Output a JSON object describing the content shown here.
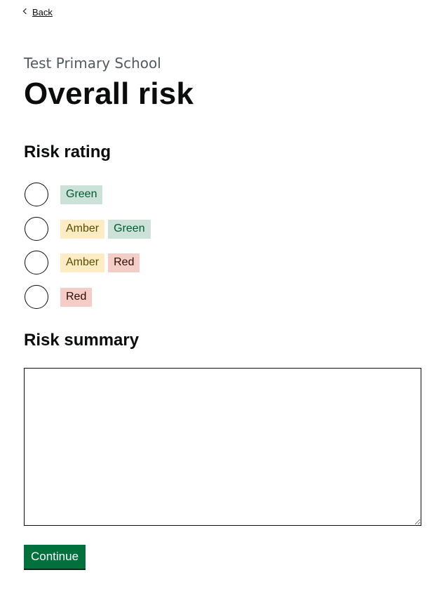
{
  "nav": {
    "back_label": "Back"
  },
  "header": {
    "caption": "Test Primary School",
    "title": "Overall risk"
  },
  "risk_rating": {
    "heading": "Risk rating",
    "options": [
      {
        "tags": [
          {
            "label": "Green",
            "color": "green"
          }
        ]
      },
      {
        "tags": [
          {
            "label": "Amber",
            "color": "amber"
          },
          {
            "label": "Green",
            "color": "green"
          }
        ]
      },
      {
        "tags": [
          {
            "label": "Amber",
            "color": "amber"
          },
          {
            "label": "Red",
            "color": "red"
          }
        ]
      },
      {
        "tags": [
          {
            "label": "Red",
            "color": "red"
          }
        ]
      }
    ]
  },
  "risk_summary": {
    "heading": "Risk summary",
    "value": ""
  },
  "actions": {
    "continue_label": "Continue"
  },
  "colors": {
    "button_green": "#00703c",
    "tag_green_bg": "#cce2d8",
    "tag_amber_bg": "#ffebc4",
    "tag_red_bg": "#f4cdc6"
  }
}
